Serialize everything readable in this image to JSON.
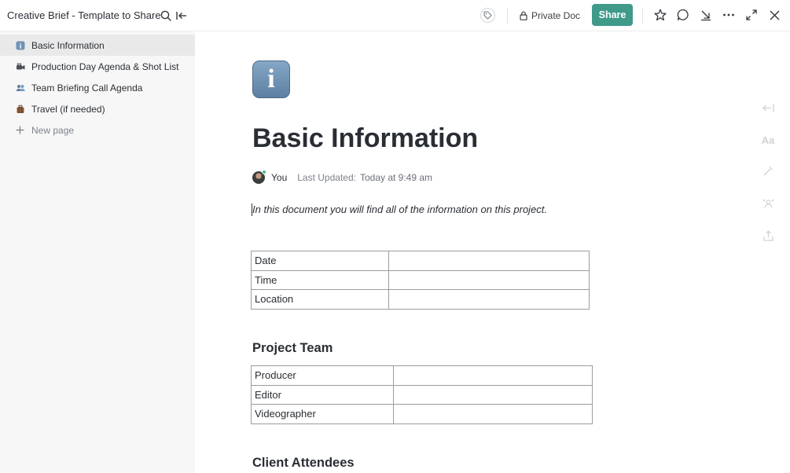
{
  "topbar": {
    "title": "Creative Brief - Template to Share",
    "private_label": "Private Doc",
    "share_label": "Share"
  },
  "sidebar": {
    "items": [
      {
        "label": "Basic Information",
        "icon": "info-emoji",
        "active": true
      },
      {
        "label": "Production Day Agenda & Shot List",
        "icon": "video-camera-emoji"
      },
      {
        "label": "Team Briefing Call Agenda",
        "icon": "people-emoji"
      },
      {
        "label": "Travel (if needed)",
        "icon": "luggage-emoji"
      }
    ],
    "new_page_label": "New page"
  },
  "doc": {
    "page_icon_char": "i",
    "title": "Basic Information",
    "author": "You",
    "updated_label": "Last Updated:",
    "updated_value": "Today at 9:49 am",
    "intro": "In this document you will find all of the information on this project.",
    "table1": {
      "rows": [
        {
          "key": "Date",
          "value": ""
        },
        {
          "key": "Time",
          "value": ""
        },
        {
          "key": "Location",
          "value": ""
        }
      ]
    },
    "project_team_heading": "Project Team",
    "table2": {
      "rows": [
        {
          "key": "Producer",
          "value": ""
        },
        {
          "key": "Editor",
          "value": ""
        },
        {
          "key": "Videographer",
          "value": ""
        }
      ]
    },
    "client_attendees_heading": "Client Attendees"
  },
  "rail": {
    "aa_label": "Aa"
  },
  "colors": {
    "accent": "#3f9a8a",
    "sidebar_bg": "#f7f7f7",
    "sidebar_active": "#e9e9e9"
  }
}
